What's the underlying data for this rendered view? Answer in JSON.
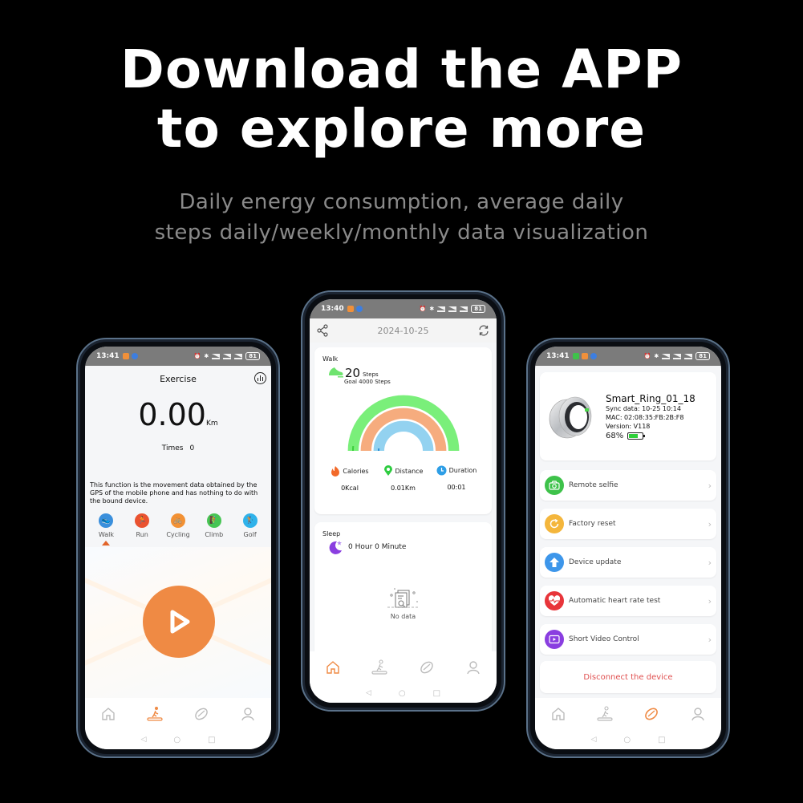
{
  "headline": {
    "line1": "Download the APP",
    "line2": "to explore more"
  },
  "subline": {
    "line1": "Daily energy consumption, average daily",
    "line2": "steps daily/weekly/monthly data visualization"
  },
  "colors": {
    "accent": "#ef8a44",
    "walk_arc": "#7aef7a",
    "calories_arc": "#f6ac7e",
    "distance_arc": "#93d2f0",
    "disconnect": "#e05050"
  },
  "phone_exercise": {
    "status": {
      "time": "13:41",
      "battery": "81"
    },
    "title": "Exercise",
    "distance_value": "0.00",
    "distance_unit": "Km",
    "times_label": "Times",
    "times_value": "0",
    "gps_note": "This function is the movement data obtained by the GPS of the mobile phone and has nothing to do with the bound device.",
    "sports": [
      {
        "label": "Walk",
        "color": "#3a8fdc",
        "icon": "walk-icon",
        "selected": true
      },
      {
        "label": "Run",
        "color": "#ea5230",
        "icon": "run-icon",
        "selected": false
      },
      {
        "label": "Cycling",
        "color": "#f29134",
        "icon": "cycling-icon",
        "selected": false
      },
      {
        "label": "Climb",
        "color": "#46c553",
        "icon": "climb-icon",
        "selected": false
      },
      {
        "label": "Golf",
        "color": "#2fb2ea",
        "icon": "golf-icon",
        "selected": false
      }
    ],
    "active_tab": "exercise"
  },
  "phone_home": {
    "status": {
      "time": "13:40",
      "battery": "81"
    },
    "date": "2024-10-25",
    "walk": {
      "label": "Walk",
      "steps": "20",
      "steps_unit": "Steps",
      "goal": "Goal 4000 Steps",
      "steps_progress": 0.005,
      "calories_progress": 0.0,
      "distance_progress": 0.01
    },
    "metrics": [
      {
        "label": "Calories",
        "value": "0Kcal",
        "icon": "flame-icon",
        "color": "#f26a2a"
      },
      {
        "label": "Distance",
        "value": "0.01Km",
        "icon": "location-pin-icon",
        "color": "#2ecc40"
      },
      {
        "label": "Duration",
        "value": "00:01",
        "icon": "clock-icon",
        "color": "#2e9ee6"
      }
    ],
    "sleep": {
      "label": "Sleep",
      "value": "0 Hour 0 Minute",
      "empty_text": "No data"
    },
    "active_tab": "home"
  },
  "phone_device": {
    "status": {
      "time": "13:41",
      "battery": "81"
    },
    "device": {
      "name": "Smart_Ring_01_18",
      "sync": "Sync data: 10-25 10:14",
      "mac": "MAC: 02:08:35:FB:2B:F8",
      "version": "Version: V118",
      "battery": "68%",
      "battery_level": 0.68
    },
    "menu": [
      {
        "label": "Remote selfie",
        "icon": "camera-icon",
        "color": "#3ec24a"
      },
      {
        "label": "Factory reset",
        "icon": "reset-icon",
        "color": "#f4b63c"
      },
      {
        "label": "Device update",
        "icon": "upload-arrow-icon",
        "color": "#3d96ea"
      },
      {
        "label": "Automatic heart rate test",
        "icon": "heart-rate-icon",
        "color": "#e8353a"
      },
      {
        "label": "Short Video Control",
        "icon": "video-icon",
        "color": "#8a3ee0"
      }
    ],
    "disconnect_label": "Disconnect the device",
    "active_tab": "device"
  }
}
